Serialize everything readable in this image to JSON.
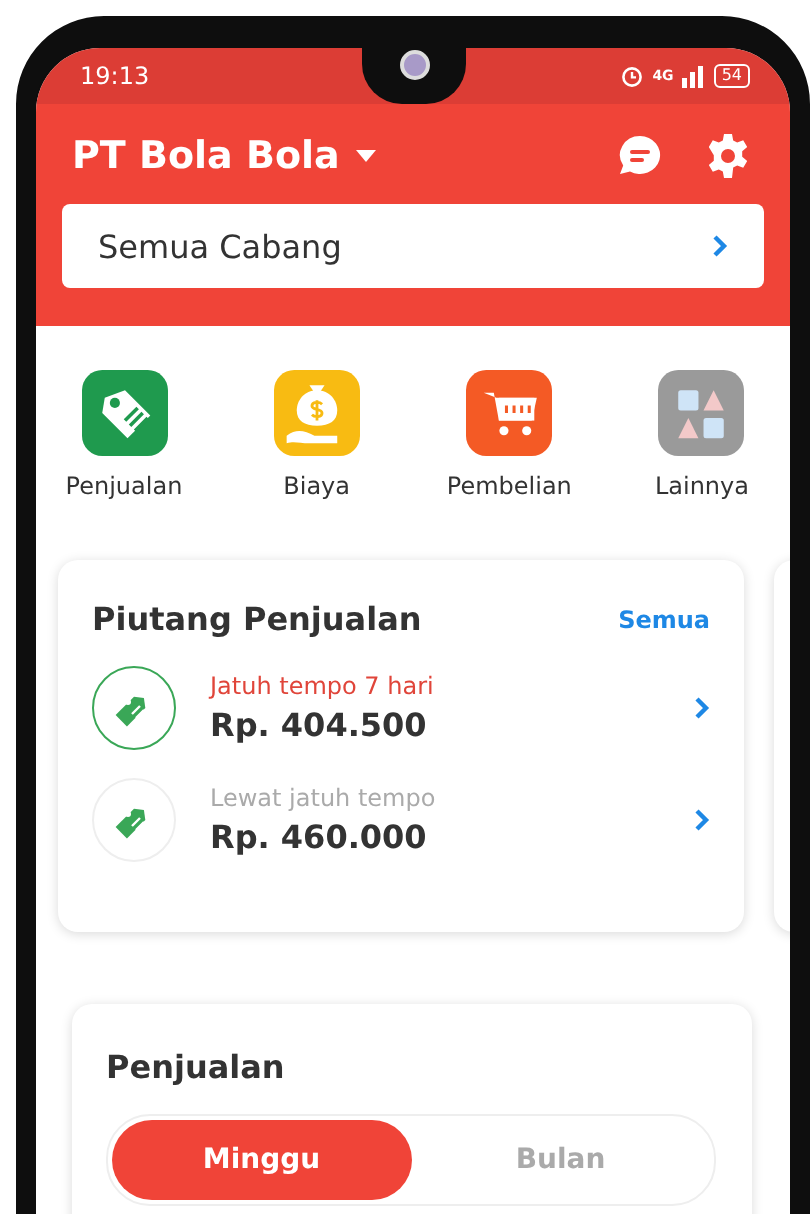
{
  "status_bar": {
    "time": "19:13",
    "network": "4G",
    "battery": "54"
  },
  "header": {
    "title": "PT Bola Bola",
    "branch": "Semua Cabang"
  },
  "shortcuts": [
    {
      "label": "Penjualan",
      "kind": "tag",
      "color": "#1f9a4e"
    },
    {
      "label": "Biaya",
      "kind": "money",
      "color": "#f8bb12"
    },
    {
      "label": "Pembelian",
      "kind": "cart",
      "color": "#f45a25"
    },
    {
      "label": "Lainnya",
      "kind": "more",
      "color": "#9a9a9a"
    }
  ],
  "receivables": {
    "title": "Piutang Penjualan",
    "link": "Semua",
    "items": [
      {
        "label": "Jatuh tempo 7 hari",
        "amount": "Rp. 404.500",
        "kind": "due_soon"
      },
      {
        "label": "Lewat jatuh tempo",
        "amount": "Rp. 460.000",
        "kind": "overdue"
      }
    ]
  },
  "sales": {
    "title": "Penjualan",
    "tabs": [
      {
        "label": "Minggu",
        "selected": true
      },
      {
        "label": "Bulan",
        "selected": false
      }
    ]
  }
}
